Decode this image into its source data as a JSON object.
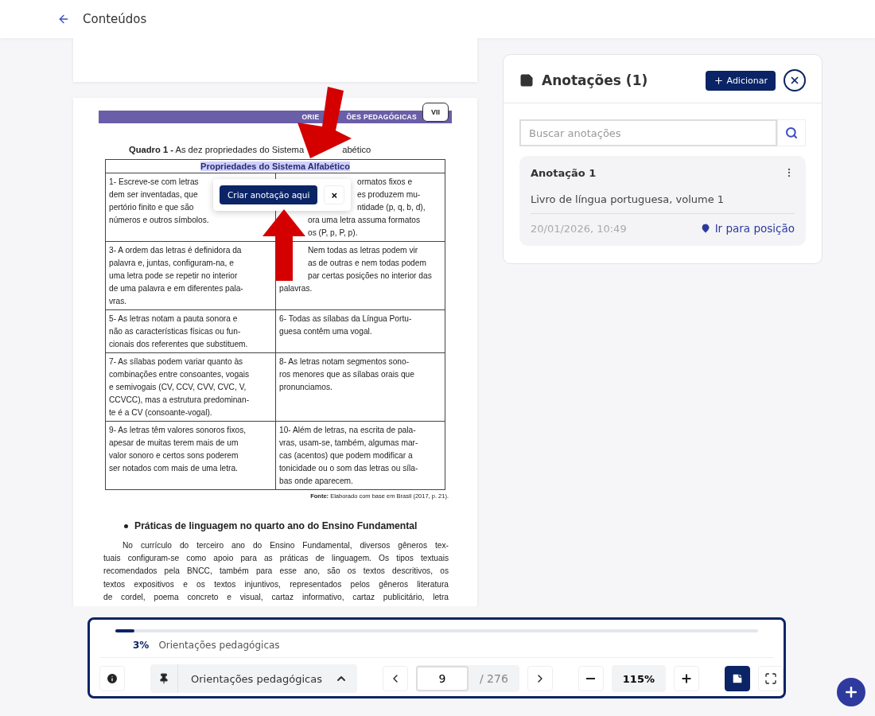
{
  "header": {
    "title": "Conteúdos"
  },
  "document": {
    "banner": {
      "parts": [
        "ORIE",
        "ÕES PEDAGÓGICAS"
      ],
      "badge": "VII"
    },
    "caption": {
      "label": "Quadro 1 -",
      "parts": [
        "As dez propriedades do Sistema",
        "abético"
      ]
    },
    "table": {
      "heading": "Propriedades do Sistema Alfabético",
      "heading_highlighted": true,
      "rows": [
        [
          {
            "lines": [
              {
                "text": "1- Escreve-se com letras"
              },
              {
                "text": "dem ser inventadas, que"
              },
              {
                "text": "pertório finito e que são"
              },
              {
                "text": "números e outros símbolos."
              }
            ]
          },
          {
            "lines": [
              {
                "text": "ormatos fixos e",
                "under_popup": true
              },
              {
                "text": "es produzem mu-",
                "under_popup": true
              },
              {
                "text": "ntidade (p, q, b, d),",
                "under_popup": true
              },
              {
                "text": "ora uma letra assuma formatos",
                "under_arrow": true
              },
              {
                "text": "os (P, p, P, p).",
                "under_arrow": true
              }
            ]
          }
        ],
        [
          {
            "lines": [
              {
                "text": "3- A ordem das letras é definidora da"
              },
              {
                "text": "palavra e, juntas, configuram-na, e"
              },
              {
                "text": "uma letra pode se repetir no interior"
              },
              {
                "text": "de uma palavra e em diferentes pala-"
              },
              {
                "text": "vras."
              }
            ]
          },
          {
            "lines": [
              {
                "text": "Nem todas as letras podem vir",
                "under_arrow": true
              },
              {
                "text": "as de outras e nem todas podem",
                "under_arrow": true
              },
              {
                "text": "par certas posições no interior das",
                "under_arrow": true
              },
              {
                "text": "palavras."
              }
            ]
          }
        ],
        [
          {
            "lines": [
              {
                "text": "5- As letras notam a pauta sonora e"
              },
              {
                "text": "não as características físicas ou fun-"
              },
              {
                "text": "cionais dos referentes que substituem."
              }
            ]
          },
          {
            "lines": [
              {
                "text": "6- Todas as sílabas da Língua Portu-"
              },
              {
                "text": "guesa contêm uma vogal."
              }
            ]
          }
        ],
        [
          {
            "lines": [
              {
                "text": "7- As sílabas podem variar quanto às"
              },
              {
                "text": "combinações entre consoantes, vogais"
              },
              {
                "text": "e semivogais (CV, CCV, CVV, CVC, V,"
              },
              {
                "text": "CCVCC), mas a estrutura predominan-"
              },
              {
                "text": "te é a CV (consoante-vogal)."
              }
            ]
          },
          {
            "lines": [
              {
                "text": "8- As letras notam segmentos sono-"
              },
              {
                "text": "ros menores que as sílabas orais que"
              },
              {
                "text": "pronunciamos."
              }
            ]
          }
        ],
        [
          {
            "lines": [
              {
                "text": "9- As letras têm valores sonoros fixos,"
              },
              {
                "text": "apesar de muitas terem mais de um"
              },
              {
                "text": "valor sonoro e certos sons poderem"
              },
              {
                "text": "ser notados com mais de uma letra."
              }
            ]
          },
          {
            "lines": [
              {
                "text": "10- Além de letras, na escrita de pala-"
              },
              {
                "text": "vras, usam-se, também, algumas mar-"
              },
              {
                "text": "cas (acentos) que podem modificar a"
              },
              {
                "text": "tonicidade ou o som das letras ou síla-"
              },
              {
                "text": "bas onde aparecem."
              }
            ]
          }
        ]
      ],
      "source": "**Fonte:** Elaborado com base em Brasil (2017, p. 21)."
    },
    "section_heading": "Práticas de linguagem no quarto ano do Ensino Fundamental",
    "paragraph": [
      "No currículo do terceiro ano do Ensino Fundamental, diversos gêneros tex-",
      "tuais configuram-se como apoio para as práticas de linguagem. Os tipos textuais",
      "recomendados pela BNCC, também para esse ano, são os textos descritivos, os",
      "textos expositivos e os textos injuntivos, representados pelos gêneros literatura",
      "de cordel, poema concreto e visual, cartaz informativo, cartaz publicitário, letra"
    ]
  },
  "selection_popup": {
    "button": "Criar anotação aqui",
    "close": "×"
  },
  "notes_panel": {
    "title": "Anotações (1)",
    "add_button": "Adicionar",
    "search": {
      "placeholder": "Buscar anotações"
    },
    "notes": [
      {
        "title": "Anotação 1",
        "text": "Livro de língua portuguesa, volume 1",
        "date": "20/01/2026, 10:49",
        "link": "Ir para posição"
      }
    ]
  },
  "toolbar": {
    "progress": {
      "level": 0.03,
      "percent": "3%",
      "section": "Orientações pedagógicas"
    },
    "section_select": "Orientações pedagógicas",
    "page": "9",
    "total": "/ 276",
    "zoom": "115%",
    "notes_toggle": {
      "selected": true
    }
  }
}
